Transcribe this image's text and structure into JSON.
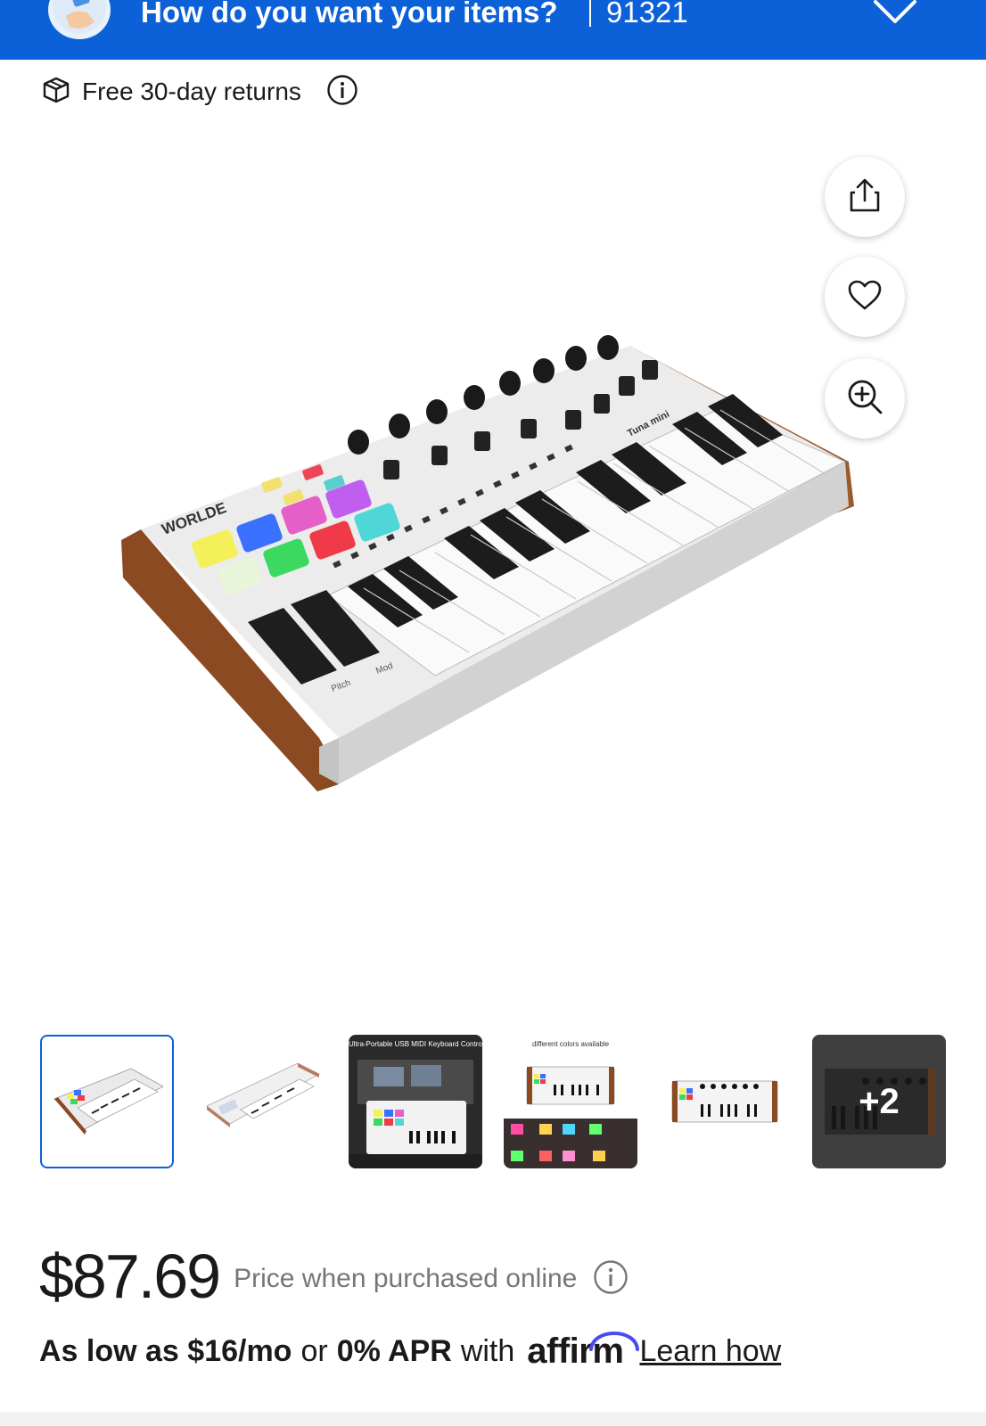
{
  "header": {
    "title": "How do you want your items?",
    "zip": "91321",
    "avatar_icon": "delivery-avatar-icon",
    "chevron_icon": "chevron-down-icon",
    "bg_color": "#0d61d8"
  },
  "returns": {
    "label": "Free 30-day returns",
    "icon": "return-box-icon",
    "info_icon": "info-icon"
  },
  "actions": {
    "share_icon": "share-icon",
    "favorite_icon": "heart-icon",
    "zoom_icon": "zoom-in-icon"
  },
  "product_image": {
    "brand_text": "WORLDE",
    "model_text": "Tuna mini",
    "pitch_label": "Pitch",
    "mod_label": "Mod"
  },
  "thumbnails": {
    "items": [
      {
        "caption": ""
      },
      {
        "caption": ""
      },
      {
        "caption": "Ultra-Portable USB MIDI Keyboard Controller"
      },
      {
        "caption": "different colors available"
      },
      {
        "caption": ""
      },
      {
        "caption": "+2"
      }
    ],
    "selected_index": 0
  },
  "price": {
    "amount": "$87.69",
    "note": "Price when purchased online",
    "info_icon": "info-icon"
  },
  "financing": {
    "low_as": "As low as $16/mo",
    "or": "or",
    "apr": "0% APR",
    "with": "with",
    "brand": "affirm",
    "learn": "Learn how"
  }
}
